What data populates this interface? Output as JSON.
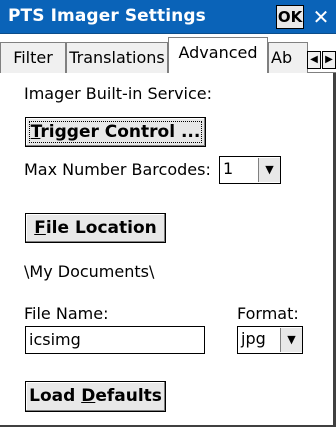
{
  "window": {
    "title": "PTS Imager Settings",
    "ok_label": "OK",
    "close_symbol": "✕"
  },
  "tabs": [
    {
      "label": "Filter",
      "active": false
    },
    {
      "label": "Translations",
      "active": false
    },
    {
      "label": "Advanced",
      "active": true
    },
    {
      "label": "Ab",
      "active": false
    }
  ],
  "tab_scroll": {
    "left_icon": "◀",
    "right_icon": "▶"
  },
  "advanced": {
    "imager_service_label": "Imager Built-in Service:",
    "trigger_button": {
      "mnemonic": "T",
      "rest": "rigger Control ..."
    },
    "max_barcodes_label": "Max Number Barcodes:",
    "max_barcodes_value": "1",
    "file_location_button": {
      "mnemonic": "F",
      "rest": "ile Location"
    },
    "file_location_path": "\\My Documents\\",
    "file_name_label": "File Name:",
    "file_name_value": "icsimg",
    "format_label": "Format:",
    "format_value": "jpg",
    "load_defaults_button": {
      "pre": "Load ",
      "mnemonic": "D",
      "rest": "efaults"
    }
  },
  "icons": {
    "dropdown_arrow": "▼"
  },
  "colors": {
    "titlebar": "#0a63b8",
    "button_face": "#e8e8e8"
  }
}
